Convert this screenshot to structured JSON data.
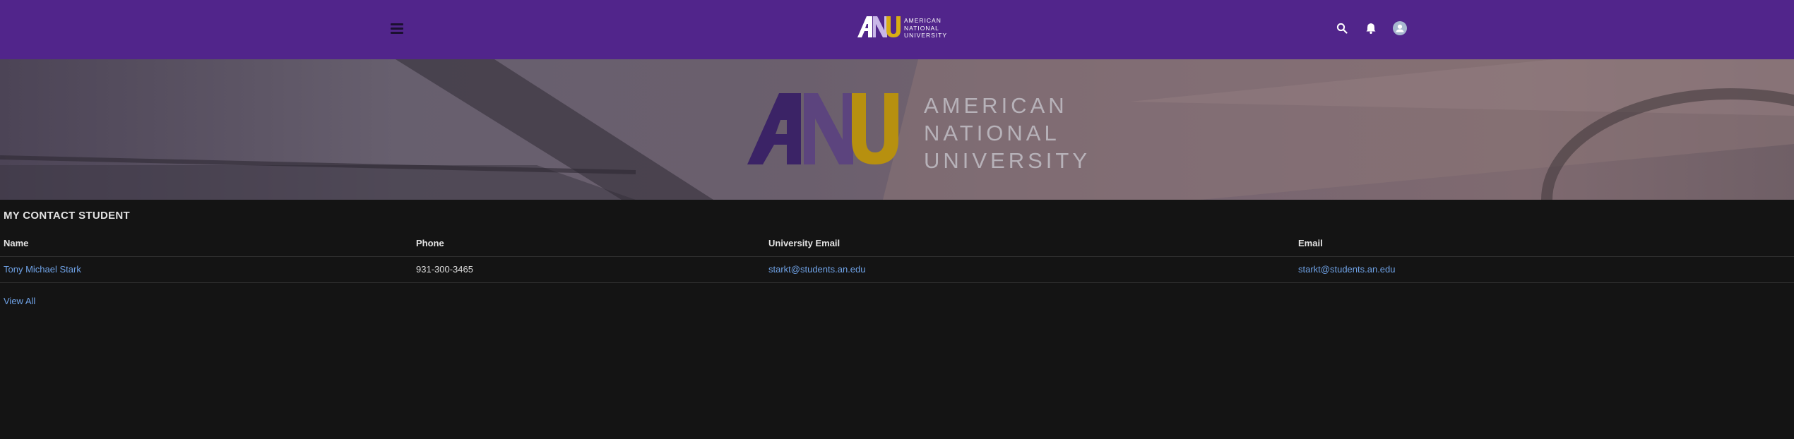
{
  "brand": {
    "logo_word_1": "AMERICAN",
    "logo_word_2": "NATIONAL",
    "logo_word_3": "UNIVERSITY",
    "primary_color": "#51258b",
    "gold_color": "#d8ad13"
  },
  "nav": {
    "menu_icon": "hamburger-menu-icon",
    "search_icon": "search-icon",
    "notifications_icon": "bell-icon",
    "profile_icon": "user-avatar-icon"
  },
  "contacts": {
    "title": "MY CONTACT STUDENT",
    "columns": [
      "Name",
      "Phone",
      "University Email",
      "Email"
    ],
    "rows": [
      {
        "name": "Tony Michael Stark",
        "phone": "931-300-3465",
        "university_email": "starkt@students.an.edu",
        "email": "starkt@students.an.edu"
      }
    ],
    "view_all": "View All",
    "link_color": "#6fa2e6"
  }
}
